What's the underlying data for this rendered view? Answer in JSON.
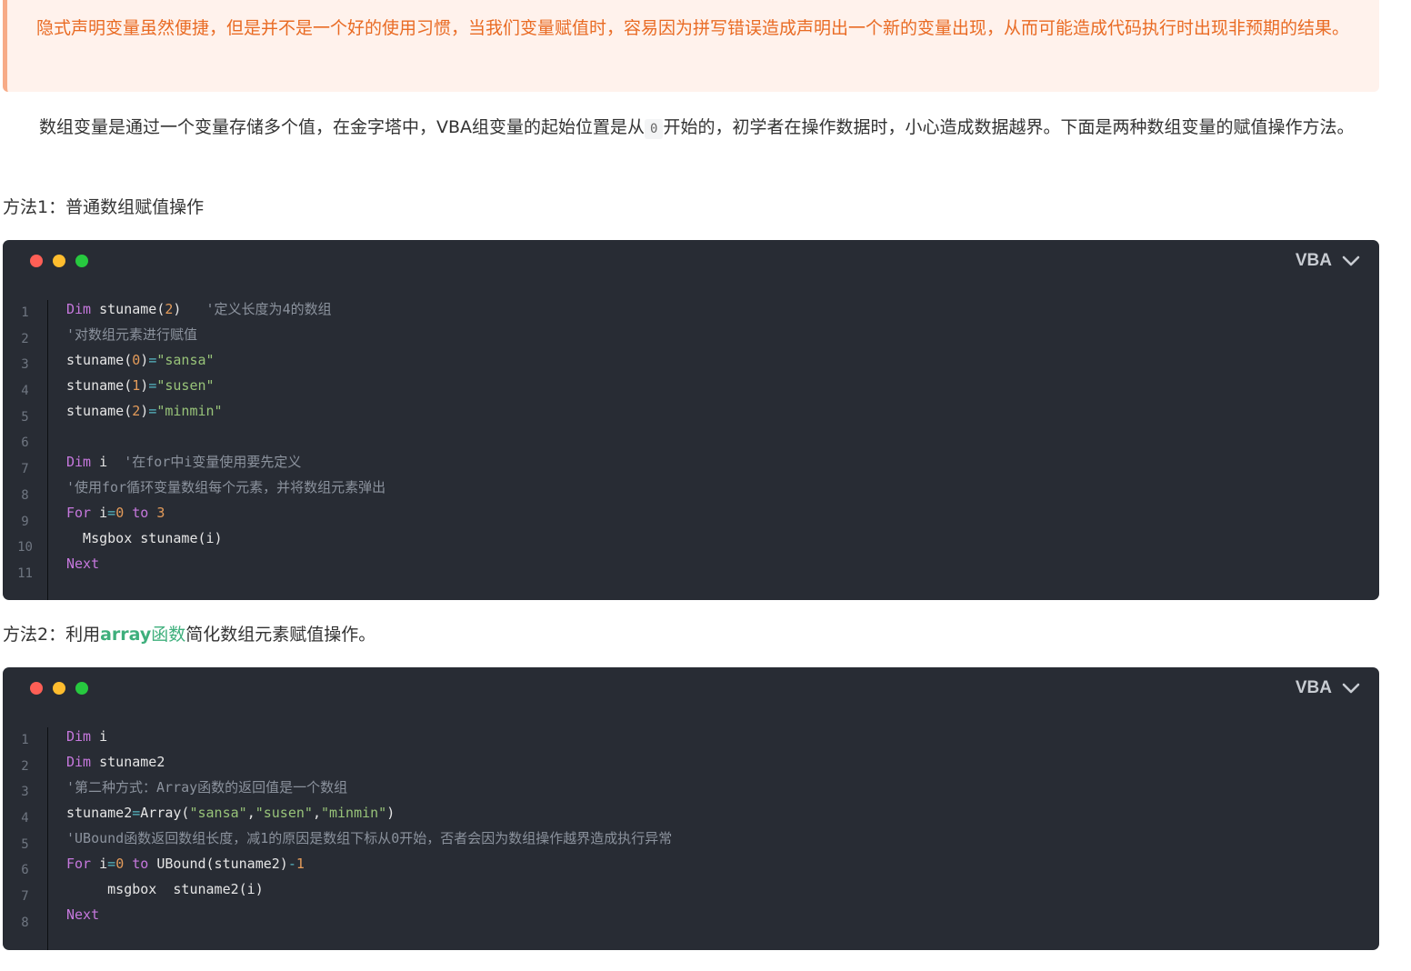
{
  "notice": {
    "text": "隐式声明变量虽然便捷，但是并不是一个好的使用习惯，当我们变量赋值时，容易因为拼写错误造成声明出一个新的变量出现，从而可能造成代码执行时出现非预期的结果。"
  },
  "intro": {
    "before": "数组变量是通过一个变量存储多个值，在金字塔中，VBA组变量的起始位置是从",
    "code": "0",
    "after": "开始的，初学者在操作数据时，小心造成数据越界。下面是两种数组变量的赋值操作方法。"
  },
  "method1": {
    "title": "方法1：普通数组赋值操作"
  },
  "method2": {
    "before": "方法2：利用",
    "link_bold": "array",
    "link_rest": "函数",
    "after": "简化数组元素赋值操作。"
  },
  "colors": {
    "dot_red": "#ff5f56",
    "dot_yellow": "#ffbd2e",
    "dot_green": "#27c93f"
  },
  "code_blocks": [
    {
      "lang": "VBA",
      "line_numbers": [
        "1",
        "2",
        "3",
        "4",
        "5",
        "6",
        "7",
        "8",
        "9",
        "10",
        "11"
      ],
      "lines": [
        [
          {
            "t": "Dim",
            "c": "kw"
          },
          {
            "t": " stuname",
            "c": "pl"
          },
          {
            "t": "(",
            "c": "pl"
          },
          {
            "t": "2",
            "c": "num"
          },
          {
            "t": ")   ",
            "c": "pl"
          },
          {
            "t": "'定义长度为4的数组",
            "c": "cm"
          }
        ],
        [
          {
            "t": "'对数组元素进行赋值",
            "c": "cm"
          }
        ],
        [
          {
            "t": "stuname",
            "c": "pl"
          },
          {
            "t": "(",
            "c": "pl"
          },
          {
            "t": "0",
            "c": "num"
          },
          {
            "t": ")",
            "c": "pl"
          },
          {
            "t": "=",
            "c": "op"
          },
          {
            "t": "\"sansa\"",
            "c": "str"
          }
        ],
        [
          {
            "t": "stuname",
            "c": "pl"
          },
          {
            "t": "(",
            "c": "pl"
          },
          {
            "t": "1",
            "c": "num"
          },
          {
            "t": ")",
            "c": "pl"
          },
          {
            "t": "=",
            "c": "op"
          },
          {
            "t": "\"susen\"",
            "c": "str"
          }
        ],
        [
          {
            "t": "stuname",
            "c": "pl"
          },
          {
            "t": "(",
            "c": "pl"
          },
          {
            "t": "2",
            "c": "num"
          },
          {
            "t": ")",
            "c": "pl"
          },
          {
            "t": "=",
            "c": "op"
          },
          {
            "t": "\"minmin\"",
            "c": "str"
          }
        ],
        [],
        [
          {
            "t": "Dim",
            "c": "kw"
          },
          {
            "t": " i  ",
            "c": "pl"
          },
          {
            "t": "'在for中i变量使用要先定义",
            "c": "cm"
          }
        ],
        [
          {
            "t": "'使用for循环变量数组每个元素，并将数组元素弹出",
            "c": "cm"
          }
        ],
        [
          {
            "t": "For",
            "c": "kw"
          },
          {
            "t": " i",
            "c": "pl"
          },
          {
            "t": "=",
            "c": "op"
          },
          {
            "t": "0",
            "c": "num"
          },
          {
            "t": " to ",
            "c": "kw"
          },
          {
            "t": "3",
            "c": "num"
          }
        ],
        [
          {
            "t": "  Msgbox stuname(i)",
            "c": "pl"
          }
        ],
        [
          {
            "t": "Next",
            "c": "kw"
          }
        ]
      ]
    },
    {
      "lang": "VBA",
      "line_numbers": [
        "1",
        "2",
        "3",
        "4",
        "5",
        "6",
        "7",
        "8"
      ],
      "lines": [
        [
          {
            "t": "Dim",
            "c": "kw"
          },
          {
            "t": " i",
            "c": "pl"
          }
        ],
        [
          {
            "t": "Dim",
            "c": "kw"
          },
          {
            "t": " stuname2",
            "c": "pl"
          }
        ],
        [
          {
            "t": "'第二种方式：Array函数的返回值是一个数组",
            "c": "cm"
          }
        ],
        [
          {
            "t": "stuname2",
            "c": "pl"
          },
          {
            "t": "=",
            "c": "op"
          },
          {
            "t": "Array(",
            "c": "pl"
          },
          {
            "t": "\"sansa\"",
            "c": "str"
          },
          {
            "t": ",",
            "c": "pl"
          },
          {
            "t": "\"susen\"",
            "c": "str"
          },
          {
            "t": ",",
            "c": "pl"
          },
          {
            "t": "\"minmin\"",
            "c": "str"
          },
          {
            "t": ")",
            "c": "pl"
          }
        ],
        [
          {
            "t": "'UBound函数返回数组长度，减1的原因是数组下标从0开始，否者会因为数组操作越界造成执行异常",
            "c": "cm"
          }
        ],
        [
          {
            "t": "For",
            "c": "kw"
          },
          {
            "t": " i",
            "c": "pl"
          },
          {
            "t": "=",
            "c": "op"
          },
          {
            "t": "0",
            "c": "num"
          },
          {
            "t": " to ",
            "c": "kw"
          },
          {
            "t": "UBound(stuname2)",
            "c": "pl"
          },
          {
            "t": "-",
            "c": "op"
          },
          {
            "t": "1",
            "c": "num"
          }
        ],
        [
          {
            "t": "     msgbox  stuname2(i)",
            "c": "pl"
          }
        ],
        [
          {
            "t": "Next",
            "c": "kw"
          }
        ]
      ]
    }
  ]
}
